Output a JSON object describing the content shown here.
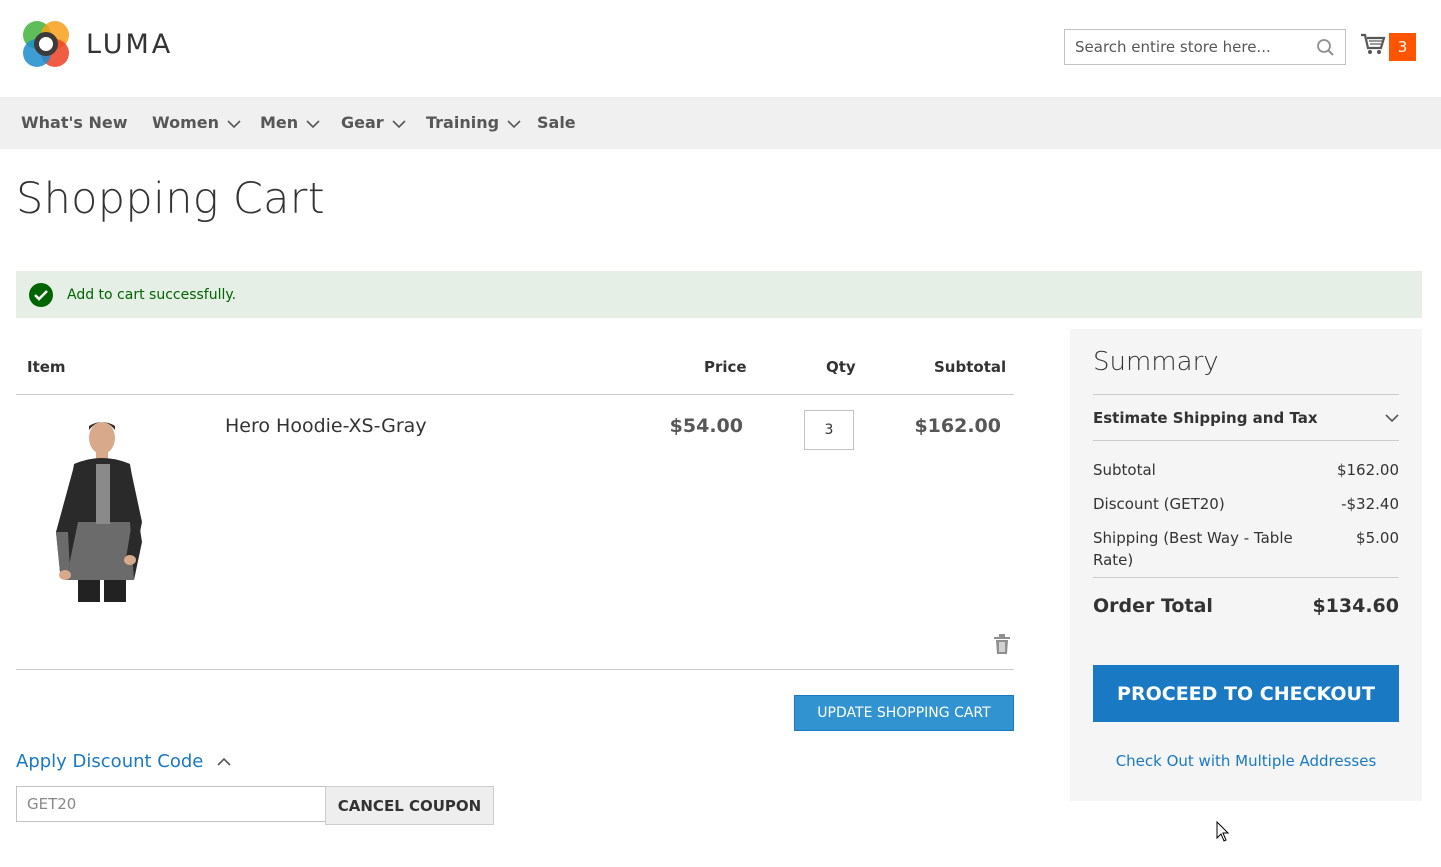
{
  "header": {
    "logo_text": "LUMA",
    "search_placeholder": "Search entire store here...",
    "cart_count": "3"
  },
  "nav": {
    "items": [
      {
        "label": "What's New"
      },
      {
        "label": "Women"
      },
      {
        "label": "Men"
      },
      {
        "label": "Gear"
      },
      {
        "label": "Training"
      },
      {
        "label": "Sale"
      }
    ]
  },
  "page_title": "Shopping Cart",
  "message": "Add to cart successfully.",
  "cart": {
    "headers": {
      "item": "Item",
      "price": "Price",
      "qty": "Qty",
      "subtotal": "Subtotal"
    },
    "items": [
      {
        "name": "Hero Hoodie-XS-Gray",
        "price": "$54.00",
        "qty": "3",
        "subtotal": "$162.00"
      }
    ],
    "update_label": "Update Shopping Cart"
  },
  "discount": {
    "title": "Apply Discount Code",
    "code": "GET20",
    "cancel_label": "Cancel Coupon"
  },
  "summary": {
    "title": "Summary",
    "estimate_label": "Estimate Shipping and Tax",
    "rows": [
      {
        "label": "Subtotal",
        "value": "$162.00"
      },
      {
        "label": "Discount (GET20)",
        "value": "-$32.40"
      },
      {
        "label": "Shipping (Best Way - Table Rate)",
        "value": "$5.00"
      }
    ],
    "total_label": "Order Total",
    "total_value": "$134.60",
    "checkout_label": "Proceed to Checkout",
    "multi_label": "Check Out with Multiple Addresses"
  },
  "colors": {
    "accent": "#1979c3",
    "cart_badge": "#ff5501",
    "success_bg": "#e5efe5",
    "success_text": "#006400"
  }
}
